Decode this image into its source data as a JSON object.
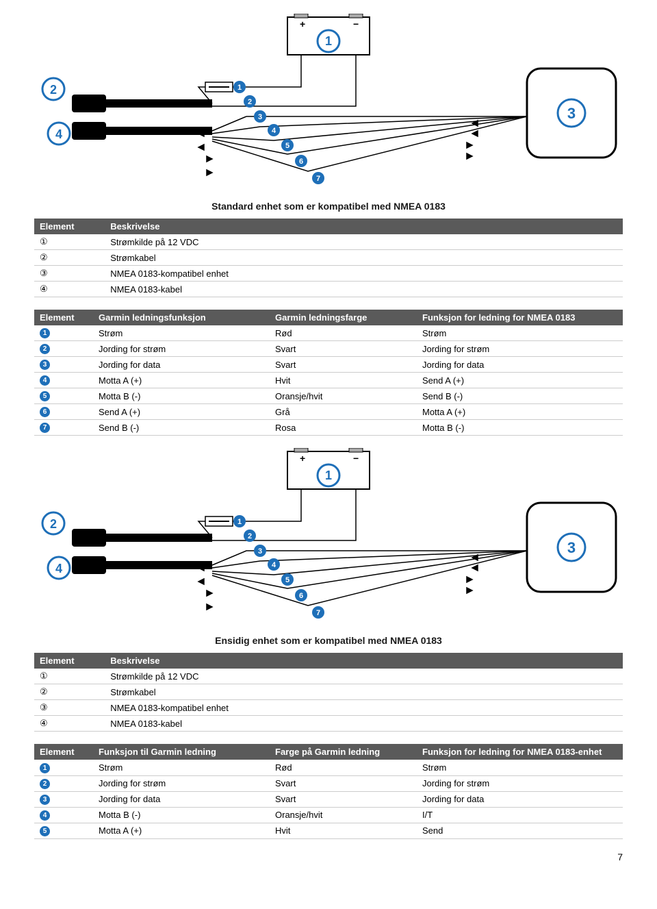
{
  "caption1": "Standard enhet som er kompatibel med NMEA 0183",
  "caption2": "Ensidig enhet som er kompatibel med NMEA 0183",
  "table1": {
    "headers": [
      "Element",
      "Beskrivelse"
    ],
    "rows": [
      {
        "k": "①",
        "v": "Strømkilde på 12 VDC"
      },
      {
        "k": "②",
        "v": "Strømkabel"
      },
      {
        "k": "③",
        "v": "NMEA 0183-kompatibel enhet"
      },
      {
        "k": "④",
        "v": "NMEA 0183-kabel"
      }
    ]
  },
  "table2": {
    "headers": [
      "Element",
      "Garmin ledningsfunksjon",
      "Garmin ledningsfarge",
      "Funksjon for ledning for NMEA 0183"
    ],
    "rows": [
      {
        "n": "1",
        "a": "Strøm",
        "b": "Rød",
        "c": "Strøm"
      },
      {
        "n": "2",
        "a": "Jording for strøm",
        "b": "Svart",
        "c": "Jording for strøm"
      },
      {
        "n": "3",
        "a": "Jording for data",
        "b": "Svart",
        "c": "Jording for data"
      },
      {
        "n": "4",
        "a": "Motta A (+)",
        "b": "Hvit",
        "c": "Send A (+)"
      },
      {
        "n": "5",
        "a": "Motta B (-)",
        "b": "Oransje/hvit",
        "c": "Send B (-)"
      },
      {
        "n": "6",
        "a": "Send A (+)",
        "b": "Grå",
        "c": "Motta A (+)"
      },
      {
        "n": "7",
        "a": "Send B (-)",
        "b": "Rosa",
        "c": "Motta B (-)"
      }
    ]
  },
  "table3": {
    "headers": [
      "Element",
      "Beskrivelse"
    ],
    "rows": [
      {
        "k": "①",
        "v": "Strømkilde på 12 VDC"
      },
      {
        "k": "②",
        "v": "Strømkabel"
      },
      {
        "k": "③",
        "v": "NMEA 0183-kompatibel enhet"
      },
      {
        "k": "④",
        "v": "NMEA 0183-kabel"
      }
    ]
  },
  "table4": {
    "headers": [
      "Element",
      "Funksjon til Garmin ledning",
      "Farge på Garmin ledning",
      "Funksjon for ledning for NMEA 0183-enhet"
    ],
    "rows": [
      {
        "n": "1",
        "a": "Strøm",
        "b": "Rød",
        "c": "Strøm"
      },
      {
        "n": "2",
        "a": "Jording for strøm",
        "b": "Svart",
        "c": "Jording for strøm"
      },
      {
        "n": "3",
        "a": "Jording for data",
        "b": "Svart",
        "c": "Jording for data"
      },
      {
        "n": "4",
        "a": "Motta B (-)",
        "b": "Oransje/hvit",
        "c": "I/T"
      },
      {
        "n": "5",
        "a": "Motta A (+)",
        "b": "Hvit",
        "c": "Send"
      }
    ]
  },
  "pagenum": "7"
}
